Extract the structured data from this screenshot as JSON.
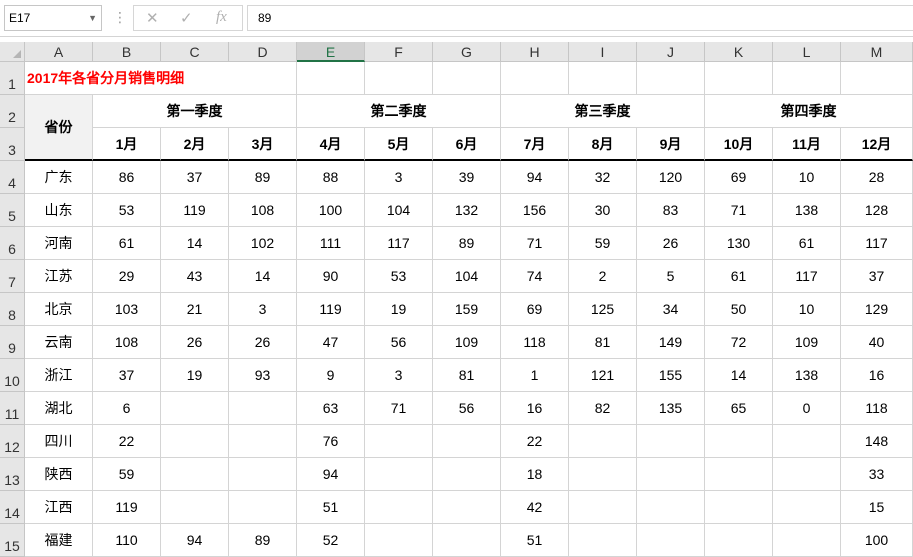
{
  "name_box": "E17",
  "formula_value": "89",
  "formula_buttons": {
    "cancel": "✕",
    "enter": "✓",
    "fx": "fx"
  },
  "columns": [
    "A",
    "B",
    "C",
    "D",
    "E",
    "F",
    "G",
    "H",
    "I",
    "J",
    "K",
    "L",
    "M"
  ],
  "rows": [
    "1",
    "2",
    "3",
    "4",
    "5",
    "6",
    "7",
    "8",
    "9",
    "10",
    "11",
    "12",
    "13",
    "14"
  ],
  "title": "2017年各省分月销售明细",
  "header": {
    "province": "省份",
    "quarters": [
      "第一季度",
      "第二季度",
      "第三季度",
      "第四季度"
    ],
    "months": [
      "1月",
      "2月",
      "3月",
      "4月",
      "5月",
      "6月",
      "7月",
      "8月",
      "9月",
      "10月",
      "11月",
      "12月"
    ]
  },
  "data": [
    [
      "广东",
      "86",
      "37",
      "89",
      "88",
      "3",
      "39",
      "94",
      "32",
      "120",
      "69",
      "10",
      "28"
    ],
    [
      "山东",
      "53",
      "119",
      "108",
      "100",
      "104",
      "132",
      "156",
      "30",
      "83",
      "71",
      "138",
      "128"
    ],
    [
      "河南",
      "61",
      "14",
      "102",
      "111",
      "117",
      "89",
      "71",
      "59",
      "26",
      "130",
      "61",
      "117"
    ],
    [
      "江苏",
      "29",
      "43",
      "14",
      "90",
      "53",
      "104",
      "74",
      "2",
      "5",
      "61",
      "117",
      "37"
    ],
    [
      "北京",
      "103",
      "21",
      "3",
      "119",
      "19",
      "159",
      "69",
      "125",
      "34",
      "50",
      "10",
      "129"
    ],
    [
      "云南",
      "108",
      "26",
      "26",
      "47",
      "56",
      "109",
      "118",
      "81",
      "149",
      "72",
      "109",
      "40"
    ],
    [
      "浙江",
      "37",
      "19",
      "93",
      "9",
      "3",
      "81",
      "1",
      "121",
      "155",
      "14",
      "138",
      "16"
    ],
    [
      "湖北",
      "6",
      "",
      "",
      "63",
      "71",
      "56",
      "16",
      "82",
      "135",
      "65",
      "0",
      "118"
    ],
    [
      "四川",
      "22",
      "",
      "",
      "76",
      "",
      "",
      "22",
      "",
      "",
      "",
      "",
      "148"
    ],
    [
      "陕西",
      "59",
      "",
      "",
      "94",
      "",
      "",
      "18",
      "",
      "",
      "",
      "",
      "33"
    ],
    [
      "江西",
      "119",
      "",
      "",
      "51",
      "",
      "",
      "42",
      "",
      "",
      "",
      "",
      "15"
    ],
    [
      "福建",
      "110",
      "94",
      "89",
      "52",
      "",
      "",
      "51",
      "",
      "",
      "",
      "",
      "100"
    ]
  ]
}
